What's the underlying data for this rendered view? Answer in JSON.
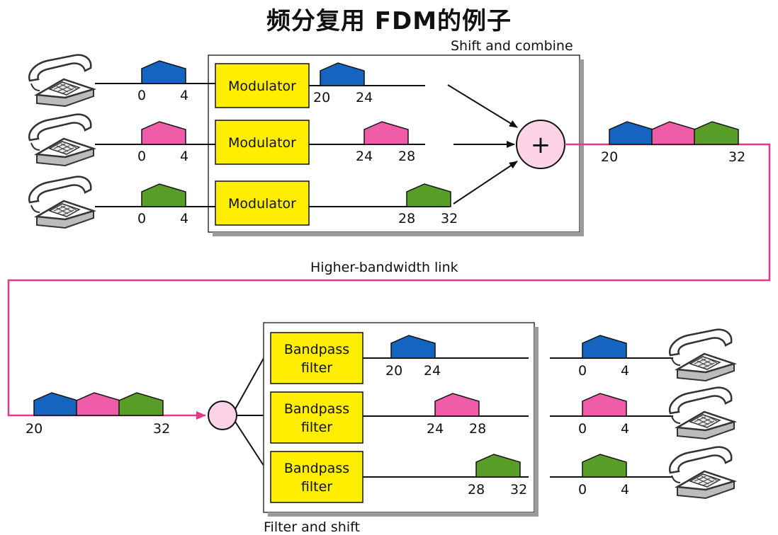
{
  "title": "频分复用 FDM的例子",
  "multiplexer": {
    "caption": "Shift and combine",
    "module_label": "Modulator",
    "combiner_symbol": "+",
    "channels": [
      {
        "color": "#1565c0",
        "input_band": [
          "0",
          "4"
        ],
        "output_band": [
          "20",
          "24"
        ]
      },
      {
        "color": "#ef5da8",
        "input_band": [
          "0",
          "4"
        ],
        "output_band": [
          "24",
          "28"
        ]
      },
      {
        "color": "#5a9e2a",
        "input_band": [
          "0",
          "4"
        ],
        "output_band": [
          "28",
          "32"
        ]
      }
    ],
    "combined_band": [
      "20",
      "32"
    ]
  },
  "link": {
    "label": "Higher-bandwidth link",
    "color": "#e8388a",
    "received_band": [
      "20",
      "32"
    ]
  },
  "demultiplexer": {
    "caption": "Filter and shift",
    "module_label_line1": "Bandpass",
    "module_label_line2": "filter",
    "channels": [
      {
        "color": "#1565c0",
        "filter_band": [
          "20",
          "24"
        ],
        "output_band": [
          "0",
          "4"
        ]
      },
      {
        "color": "#ef5da8",
        "filter_band": [
          "24",
          "28"
        ],
        "output_band": [
          "0",
          "4"
        ]
      },
      {
        "color": "#5a9e2a",
        "filter_band": [
          "28",
          "32"
        ],
        "output_band": [
          "0",
          "4"
        ]
      }
    ]
  },
  "icons": {
    "phone": "telephone-icon",
    "spectrum": "spectrum-shape-icon"
  },
  "colors": {
    "module_fill": "#ffee00",
    "combiner_fill": "#fcd3e6",
    "link_line": "#e8388a"
  }
}
